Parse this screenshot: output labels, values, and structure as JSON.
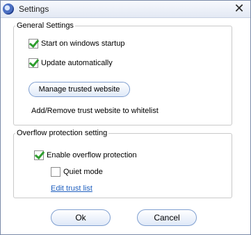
{
  "window": {
    "title": "Settings"
  },
  "general": {
    "legend": "General Settings",
    "startup": {
      "label": "Start on windows startup",
      "checked": true
    },
    "autoupdate": {
      "label": "Update automatically",
      "checked": true
    },
    "manage_button": "Manage trusted website",
    "hint": "Add/Remove trust website to whitelist"
  },
  "overflow": {
    "legend": "Overflow protection setting",
    "enable": {
      "label": "Enable overflow protection",
      "checked": true
    },
    "quiet": {
      "label": "Quiet mode",
      "checked": false
    },
    "edit_link": "Edit trust list"
  },
  "buttons": {
    "ok": "Ok",
    "cancel": "Cancel"
  },
  "icons": {
    "app": "app-globe-icon",
    "close": "close-icon"
  },
  "colors": {
    "check": "#2f9e2f",
    "link": "#1f5fbf",
    "button_border": "#7f9fd0"
  }
}
